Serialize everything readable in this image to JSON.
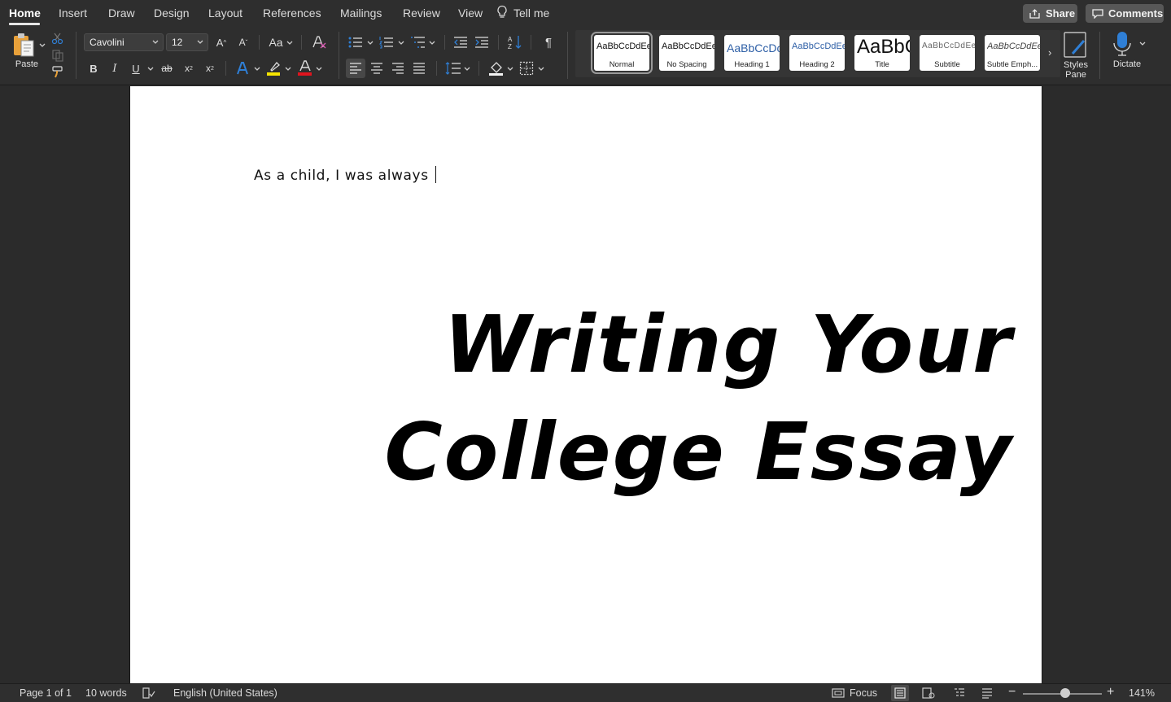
{
  "menu": {
    "tabs": [
      {
        "label": "Home",
        "active": true
      },
      {
        "label": "Insert"
      },
      {
        "label": "Draw"
      },
      {
        "label": "Design"
      },
      {
        "label": "Layout"
      },
      {
        "label": "References"
      },
      {
        "label": "Mailings"
      },
      {
        "label": "Review"
      },
      {
        "label": "View"
      }
    ],
    "tell_me": "Tell me",
    "share": "Share",
    "comments": "Comments"
  },
  "ribbon": {
    "paste_label": "Paste",
    "font_name": "Cavolini",
    "font_size": "12",
    "change_case": "Aa",
    "styles": [
      {
        "preview": "AaBbCcDdEe",
        "name": "Normal",
        "selected": true
      },
      {
        "preview": "AaBbCcDdEe",
        "name": "No Spacing"
      },
      {
        "preview": "AaBbCcDc",
        "name": "Heading 1"
      },
      {
        "preview": "AaBbCcDdEe",
        "name": "Heading 2"
      },
      {
        "preview": "AaBbC",
        "name": "Title"
      },
      {
        "preview": "AaBbCcDdEe",
        "name": "Subtitle"
      },
      {
        "preview": "AaBbCcDdEe",
        "name": "Subtle Emph..."
      }
    ],
    "styles_pane": "Styles\nPane",
    "dictate": "Dictate",
    "highlight_color": "#f5e400",
    "font_color": "#e0141e",
    "accent_color": "#2f7fd6"
  },
  "document": {
    "body_text": "As a child, I was always",
    "title_line1": "Writing Your",
    "title_line2": "College Essay"
  },
  "status": {
    "page": "Page 1 of 1",
    "words": "10 words",
    "language": "English (United States)",
    "focus": "Focus",
    "zoom": "141%",
    "zoom_percent": 141
  }
}
